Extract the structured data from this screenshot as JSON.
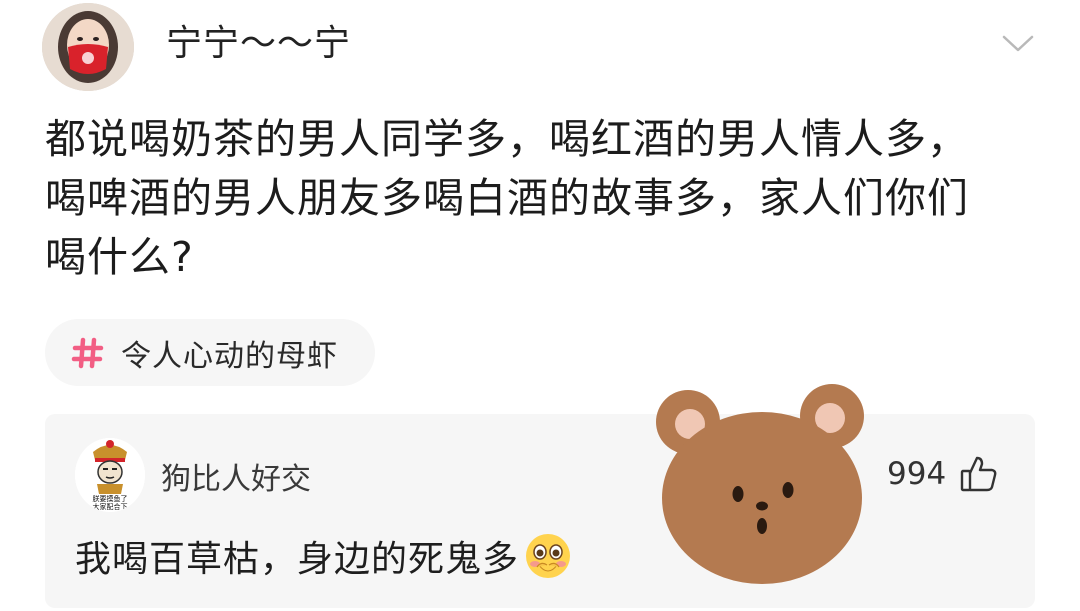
{
  "post": {
    "username": "宁宁～～宁",
    "text": "都说喝奶茶的男人同学多，喝红酒的男人情人多，\n喝啤酒的男人朋友多喝白酒的故事多，家人们你们\n喝什么?",
    "topic": "令人心动的母虾"
  },
  "comment": {
    "username": "狗比人好交",
    "likes": "994",
    "text": "我喝百草枯，身边的死鬼多",
    "avatar_caption_1": "朕要摸鱼了",
    "avatar_caption_2": "大家配合下"
  },
  "colors": {
    "topic_hash": "#f25e84",
    "card_bg": "#f6f6f6",
    "bear_brown": "#b47a50"
  }
}
